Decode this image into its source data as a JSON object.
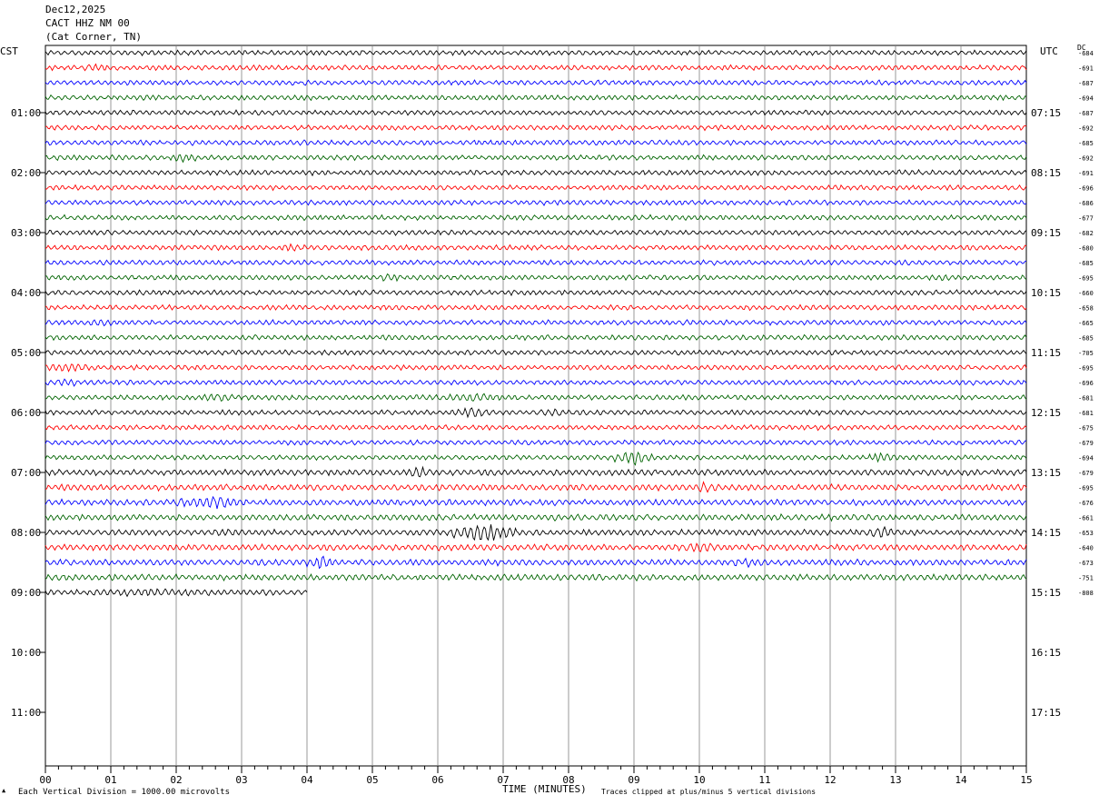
{
  "header": {
    "date": "Dec12,2025",
    "station": "CACT HHZ NM 00",
    "location": "(Cat Corner, TN)"
  },
  "left_tz": "CST",
  "right_tz": "UTC",
  "dc_label": "DC",
  "footer": {
    "scale_note": "Each Vertical Division = 1000.00 microvolts",
    "x_title": "TIME (MINUTES)",
    "clip_note": "Traces clipped at plus/minus 5 vertical divisions"
  },
  "colors": {
    "cycle": [
      "#000000",
      "#ff0000",
      "#0000ff",
      "#006400"
    ],
    "grid": "#808080"
  },
  "chart_data": {
    "type": "line",
    "title": "CACT HHZ NM 00",
    "xlabel": "TIME (MINUTES)",
    "x_range": [
      0,
      15
    ],
    "x_ticks": [
      "00",
      "01",
      "02",
      "03",
      "04",
      "05",
      "06",
      "07",
      "08",
      "09",
      "10",
      "11",
      "12",
      "13",
      "14",
      "15"
    ],
    "hour_labels_left": [
      "01:00",
      "02:00",
      "03:00",
      "04:00",
      "05:00",
      "06:00",
      "07:00",
      "08:00",
      "09:00",
      "10:00",
      "11:00"
    ],
    "hour_labels_right": [
      "07:15",
      "08:15",
      "09:15",
      "10:15",
      "11:15",
      "12:15",
      "13:15",
      "14:15",
      "15:15",
      "16:15",
      "17:15"
    ],
    "trace_count": 37,
    "last_trace_end_minute": 4.0,
    "dc_offsets": [
      "-684",
      "-691",
      "-687",
      "-694",
      "-687",
      "-692",
      "-685",
      "-692",
      "-691",
      "-696",
      "-686",
      "-677",
      "-682",
      "-680",
      "-685",
      "-695",
      "-660",
      "-658",
      "-665",
      "-685",
      "-705",
      "-695",
      "-696",
      "-681",
      "-681",
      "-675",
      "-679",
      "-694",
      "-679",
      "-695",
      "-676",
      "-661",
      "-653",
      "-640",
      "-673",
      "-751",
      "-808"
    ],
    "events": [
      {
        "trace": 1,
        "start": 0.6,
        "end": 1.0,
        "amp": 1.6
      },
      {
        "trace": 7,
        "start": 1.9,
        "end": 2.3,
        "amp": 1.7
      },
      {
        "trace": 13,
        "start": 3.6,
        "end": 4.0,
        "amp": 1.5
      },
      {
        "trace": 15,
        "start": 5.1,
        "end": 5.4,
        "amp": 1.8
      },
      {
        "trace": 15,
        "start": 13.6,
        "end": 13.8,
        "amp": 1.7
      },
      {
        "trace": 18,
        "start": 0.6,
        "end": 1.0,
        "amp": 1.5
      },
      {
        "trace": 21,
        "start": 0.0,
        "end": 0.8,
        "amp": 1.7
      },
      {
        "trace": 22,
        "start": 0.0,
        "end": 0.6,
        "amp": 1.5
      },
      {
        "trace": 23,
        "start": 2.3,
        "end": 3.0,
        "amp": 1.6
      },
      {
        "trace": 23,
        "start": 6.0,
        "end": 7.1,
        "amp": 1.6
      },
      {
        "trace": 24,
        "start": 6.2,
        "end": 6.8,
        "amp": 2.0
      },
      {
        "trace": 24,
        "start": 7.5,
        "end": 8.0,
        "amp": 1.7
      },
      {
        "trace": 27,
        "start": 8.7,
        "end": 9.3,
        "amp": 3.0
      },
      {
        "trace": 27,
        "start": 12.6,
        "end": 13.0,
        "amp": 2.2
      },
      {
        "trace": 28,
        "start": 5.5,
        "end": 5.9,
        "amp": 1.8
      },
      {
        "trace": 29,
        "start": 9.9,
        "end": 10.3,
        "amp": 1.8
      },
      {
        "trace": 30,
        "start": 2.0,
        "end": 3.1,
        "amp": 2.0
      },
      {
        "trace": 32,
        "start": 6.2,
        "end": 7.2,
        "amp": 3.0
      },
      {
        "trace": 32,
        "start": 12.6,
        "end": 13.0,
        "amp": 2.2
      },
      {
        "trace": 32,
        "start": 2.5,
        "end": 3.0,
        "amp": 1.5
      },
      {
        "trace": 33,
        "start": 9.6,
        "end": 10.3,
        "amp": 1.7
      },
      {
        "trace": 34,
        "start": 4.0,
        "end": 4.4,
        "amp": 2.2
      },
      {
        "trace": 34,
        "start": 10.5,
        "end": 11.1,
        "amp": 1.6
      },
      {
        "trace": 36,
        "start": 1.0,
        "end": 2.2,
        "amp": 1.5
      }
    ]
  }
}
